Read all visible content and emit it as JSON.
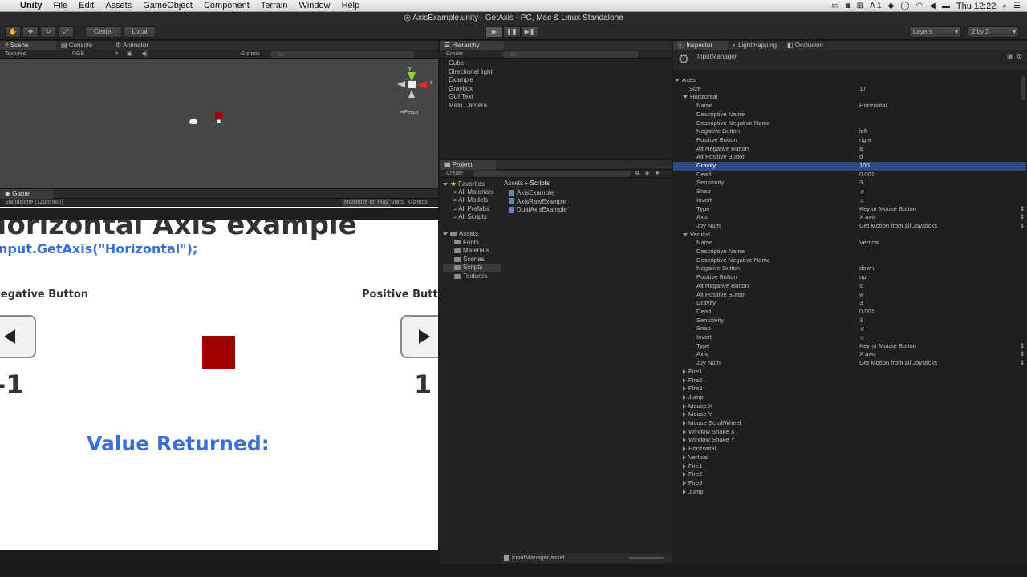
{
  "menubar": {
    "apple": "",
    "app_name": "Unity",
    "items": [
      "File",
      "Edit",
      "Assets",
      "GameObject",
      "Component",
      "Terrain",
      "Window",
      "Help"
    ],
    "clock": "Thu 12:22",
    "status_icons": [
      "display-icon",
      "camera-icon",
      "lock-icon",
      "A1-icon",
      "dropbox-icon",
      "timer-icon",
      "wifi-icon",
      "volume-icon",
      "battery-icon"
    ],
    "status_label": "A 1"
  },
  "window": {
    "title": "AxisExample.unity - GetAxis - PC, Mac & Linux Standalone"
  },
  "toolbar": {
    "center_label": "Center",
    "local_label": "Local",
    "layers_label": "Layers",
    "layout_label": "2 by 3"
  },
  "scene": {
    "tabs": [
      "Scene",
      "Console",
      "Animator"
    ],
    "shading": "Textured",
    "render": "RGB",
    "gizmos": "Gizmos",
    "search": "All",
    "persp": "Persp",
    "gizmo_axes": {
      "y": "y",
      "x": "x"
    }
  },
  "game": {
    "tab": "Game",
    "resolution": "Standalone (1200x900)",
    "maximize": "Maximize on Play",
    "stats": "Stats",
    "gizmos": "Gizmos",
    "heading": "Horizontal Axis example",
    "code": "Input.GetAxis(\"Horizontal\");",
    "negative_label": "Negative Button",
    "positive_label": "Positive Button",
    "negative_value": "-1",
    "positive_value": "1",
    "value_returned": "Value Returned:",
    "cube_color": "#a00000"
  },
  "hierarchy": {
    "tab": "Hierarchy",
    "create": "Create",
    "search": "All",
    "items": [
      "Cube",
      "Directional light",
      "Example",
      "Graybox",
      "GUI Text",
      "Main Camera"
    ]
  },
  "project": {
    "tab": "Project",
    "create": "Create",
    "favorites": {
      "label": "Favorites",
      "items": [
        "All Materials",
        "All Models",
        "All Prefabs",
        "All Scripts"
      ]
    },
    "assets": {
      "label": "Assets",
      "items": [
        "Fonts",
        "Materials",
        "Scenes",
        "Scripts",
        "Textures"
      ]
    },
    "breadcrumb": [
      "Assets",
      "Scripts"
    ],
    "files": [
      "AxisExample",
      "AxisRawExample",
      "DualAxisExample"
    ],
    "footer_file": "InputManager.asset"
  },
  "inspector": {
    "tabs": [
      "Inspector",
      "Lightmapping",
      "Occlusion"
    ],
    "title": "InputManager",
    "axes_label": "Axes",
    "size_label": "Size",
    "size_value": "17",
    "horizontal": {
      "header": "Horizontal",
      "rows": [
        {
          "label": "Name",
          "value": "Horizontal"
        },
        {
          "label": "Descriptive Name",
          "value": ""
        },
        {
          "label": "Descriptive Negative Name",
          "value": ""
        },
        {
          "label": "Negative Button",
          "value": "left"
        },
        {
          "label": "Positive Button",
          "value": "right"
        },
        {
          "label": "Alt Negative Button",
          "value": "a"
        },
        {
          "label": "Alt Positive Button",
          "value": "d"
        },
        {
          "label": "Gravity",
          "value": "100"
        },
        {
          "label": "Dead",
          "value": "0.001"
        },
        {
          "label": "Sensitivity",
          "value": "3"
        },
        {
          "label": "Snap",
          "value": "✓"
        },
        {
          "label": "Invert",
          "value": ""
        },
        {
          "label": "Type",
          "value": "Key or Mouse Button"
        },
        {
          "label": "Axis",
          "value": "X axis"
        },
        {
          "label": "Joy Num",
          "value": "Get Motion from all Joysticks"
        }
      ]
    },
    "vertical": {
      "header": "Vertical",
      "rows": [
        {
          "label": "Name",
          "value": "Vertical"
        },
        {
          "label": "Descriptive Name",
          "value": ""
        },
        {
          "label": "Descriptive Negative Name",
          "value": ""
        },
        {
          "label": "Negative Button",
          "value": "down"
        },
        {
          "label": "Positive Button",
          "value": "up"
        },
        {
          "label": "Alt Negative Button",
          "value": "s"
        },
        {
          "label": "Alt Positive Button",
          "value": "w"
        },
        {
          "label": "Gravity",
          "value": "3"
        },
        {
          "label": "Dead",
          "value": "0.001"
        },
        {
          "label": "Sensitivity",
          "value": "3"
        },
        {
          "label": "Snap",
          "value": "✓"
        },
        {
          "label": "Invert",
          "value": ""
        },
        {
          "label": "Type",
          "value": "Key or Mouse Button"
        },
        {
          "label": "Axis",
          "value": "X axis"
        },
        {
          "label": "Joy Num",
          "value": "Get Motion from all Joysticks"
        }
      ]
    },
    "collapsed": [
      "Fire1",
      "Fire2",
      "Fire3",
      "Jump",
      "Mouse X",
      "Mouse Y",
      "Mouse ScrollWheel",
      "Window Shake X",
      "Window Shake Y",
      "Horizontal",
      "Vertical",
      "Fire1",
      "Fire2",
      "Fire3",
      "Jump"
    ]
  }
}
